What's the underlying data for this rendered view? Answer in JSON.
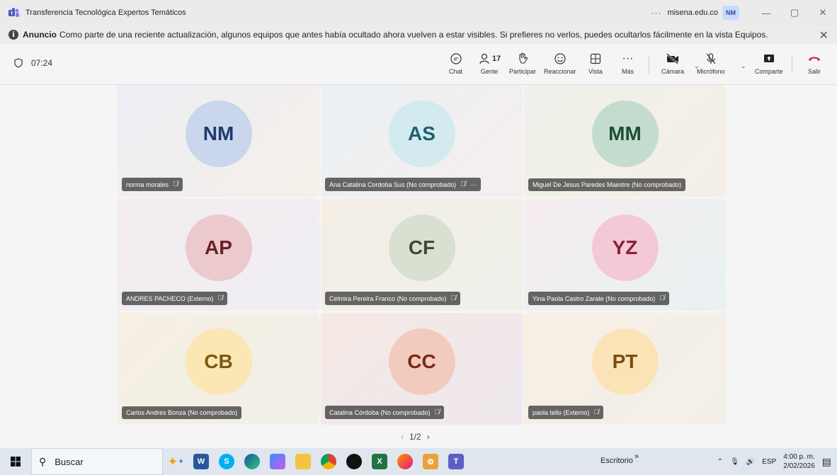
{
  "window": {
    "title": "Transferencia Tecnológica Expertos Temáticos",
    "org": "misena.edu.co",
    "user_initials": "NM",
    "more": "···",
    "minimize": "—",
    "restore": "▢",
    "close": "✕"
  },
  "announcement": {
    "bold": "Anuncio",
    "text": "Como parte de una reciente actualización, algunos equipos que antes había ocultado ahora vuelven a estar visibles. Si prefieres no verlos, puedes ocultarlos fácilmente en la vista Equipos.",
    "close": "✕"
  },
  "meeting": {
    "timer": "07:24",
    "toolbar": {
      "chat": "Chat",
      "people": "Gente",
      "people_count": "17",
      "raise": "Participar",
      "react": "Reaccionar",
      "view": "Vista",
      "more": "Más",
      "camera": "Cámara",
      "mic": "Micrófono",
      "share": "Comparte",
      "leave": "Salir"
    }
  },
  "participants": [
    {
      "initials": "NM",
      "name": "norma morales",
      "muted": true,
      "extra": "",
      "bg": "#c9d6ec",
      "fg": "#1f3a6b"
    },
    {
      "initials": "AS",
      "name": "Ana Catalina Cordoba Sus (No comprobado)",
      "muted": true,
      "extra": "···",
      "bg": "#d3eaf0",
      "fg": "#1f5f6e"
    },
    {
      "initials": "MM",
      "name": "Miguel De Jesus Paredes Maestre (No comprobado)",
      "muted": false,
      "extra": "",
      "bg": "#c3dccd",
      "fg": "#1e4d33"
    },
    {
      "initials": "AP",
      "name": "ANDRES PACHECO (Externo)",
      "muted": true,
      "extra": "",
      "bg": "#ecc9cd",
      "fg": "#6b1f27"
    },
    {
      "initials": "CF",
      "name": "Celmira Pereira Franco (No comprobado)",
      "muted": true,
      "extra": "",
      "bg": "#d9e0d2",
      "fg": "#3f4a36"
    },
    {
      "initials": "YZ",
      "name": "Yina Paola Castro Zarate (No comprobado)",
      "muted": true,
      "extra": "",
      "bg": "#f4c9d6",
      "fg": "#8a1f3f"
    },
    {
      "initials": "CB",
      "name": "Carlos Andres Bonza (No comprobado)",
      "muted": false,
      "extra": "",
      "bg": "#fbe7b3",
      "fg": "#7a5a0f"
    },
    {
      "initials": "CC",
      "name": "Catalina Córdoba (No comprobado)",
      "muted": true,
      "extra": "",
      "bg": "#f2cbbf",
      "fg": "#7a2a15"
    },
    {
      "initials": "PT",
      "name": "paola tello (Externo)",
      "muted": true,
      "extra": "",
      "bg": "#fbe3b8",
      "fg": "#7a4c0f"
    }
  ],
  "pager": {
    "prev": "‹",
    "label": "1/2",
    "next": "›"
  },
  "taskbar": {
    "search": "Buscar",
    "desktop": "Escritorio",
    "chevron": "»",
    "lang": "ESP",
    "time": "4:00 p. m.",
    "date": "2/02/2026"
  }
}
